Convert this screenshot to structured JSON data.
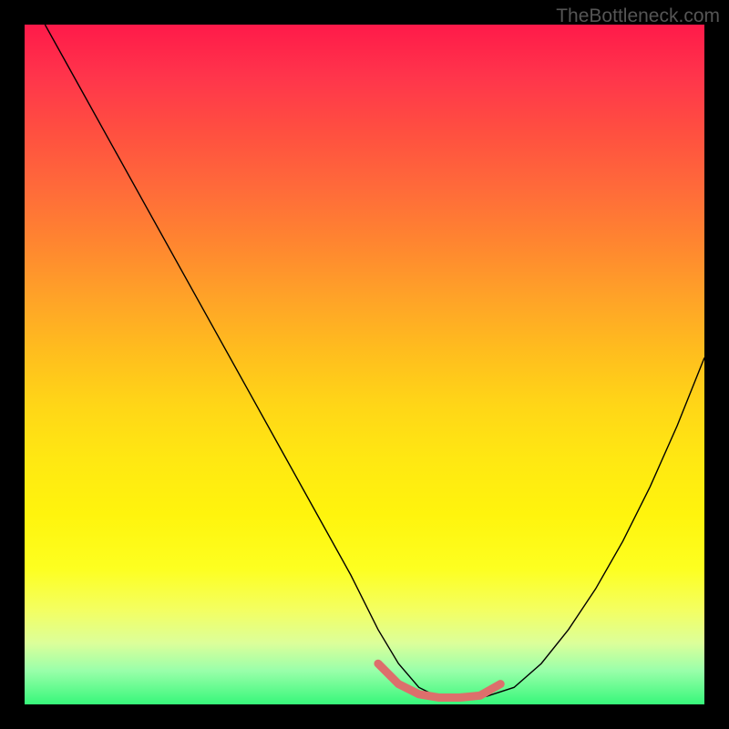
{
  "watermark": "TheBottleneck.com",
  "chart_data": {
    "type": "line",
    "title": "",
    "xlabel": "",
    "ylabel": "",
    "xlim": [
      0,
      100
    ],
    "ylim": [
      0,
      100
    ],
    "series": [
      {
        "name": "bottleneck-curve",
        "x": [
          3,
          8,
          13,
          18,
          23,
          28,
          33,
          38,
          43,
          48,
          52,
          55,
          58,
          61,
          64,
          68,
          72,
          76,
          80,
          84,
          88,
          92,
          96,
          100
        ],
        "y": [
          100,
          91,
          82,
          73,
          64,
          55,
          46,
          37,
          28,
          19,
          11,
          6,
          2.5,
          1,
          1,
          1.2,
          2.5,
          6,
          11,
          17,
          24,
          32,
          41,
          51
        ]
      }
    ],
    "highlight_region": {
      "name": "optimal-zone",
      "x": [
        52,
        55,
        58,
        61,
        64,
        67,
        70
      ],
      "y": [
        6,
        3,
        1.5,
        1,
        1,
        1.3,
        3
      ]
    },
    "gradient": {
      "top": "#ff1a4a",
      "bottom": "#37f77a"
    }
  }
}
